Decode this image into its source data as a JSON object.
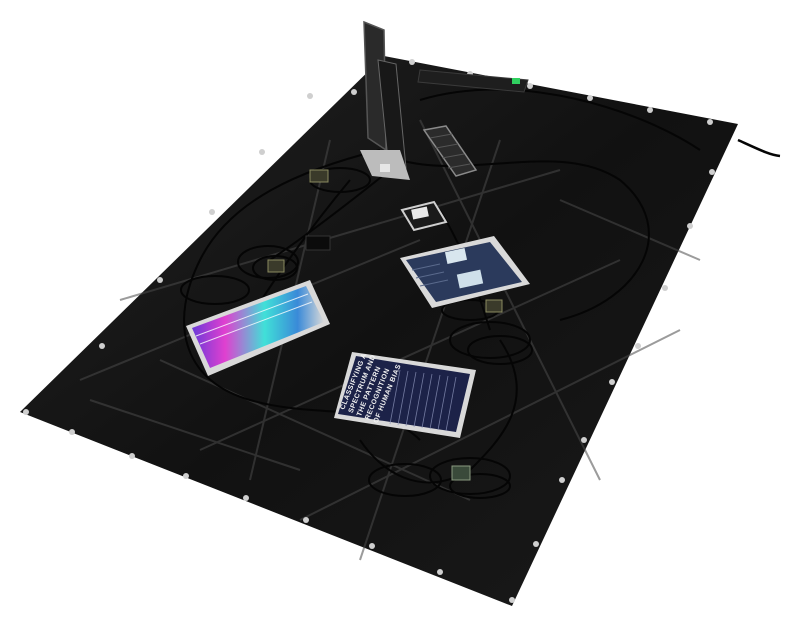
{
  "scene": {
    "description_visible": false,
    "screen_text": {
      "title_lines": [
        "CLASSIFYING A",
        "SPECTRUM AND",
        "THE PATTERN",
        "RECOGNITION",
        "OF HUMAN BIAS"
      ]
    }
  },
  "colors": {
    "background": "#ffffff",
    "tarp": "#141414",
    "tarp_highlight": "#4a4a4a",
    "cable": "#050505",
    "screen_frame": "#d9d9d9",
    "grommet": "#cfcfcf",
    "spectrum_magenta": "#e040d0",
    "spectrum_cyan": "#40e0d8",
    "spectrum_blue": "#3a5ad8",
    "text_screen_bg": "#1c2248",
    "ui_screen_bg": "#2b3a5c",
    "led_green": "#30d060"
  }
}
